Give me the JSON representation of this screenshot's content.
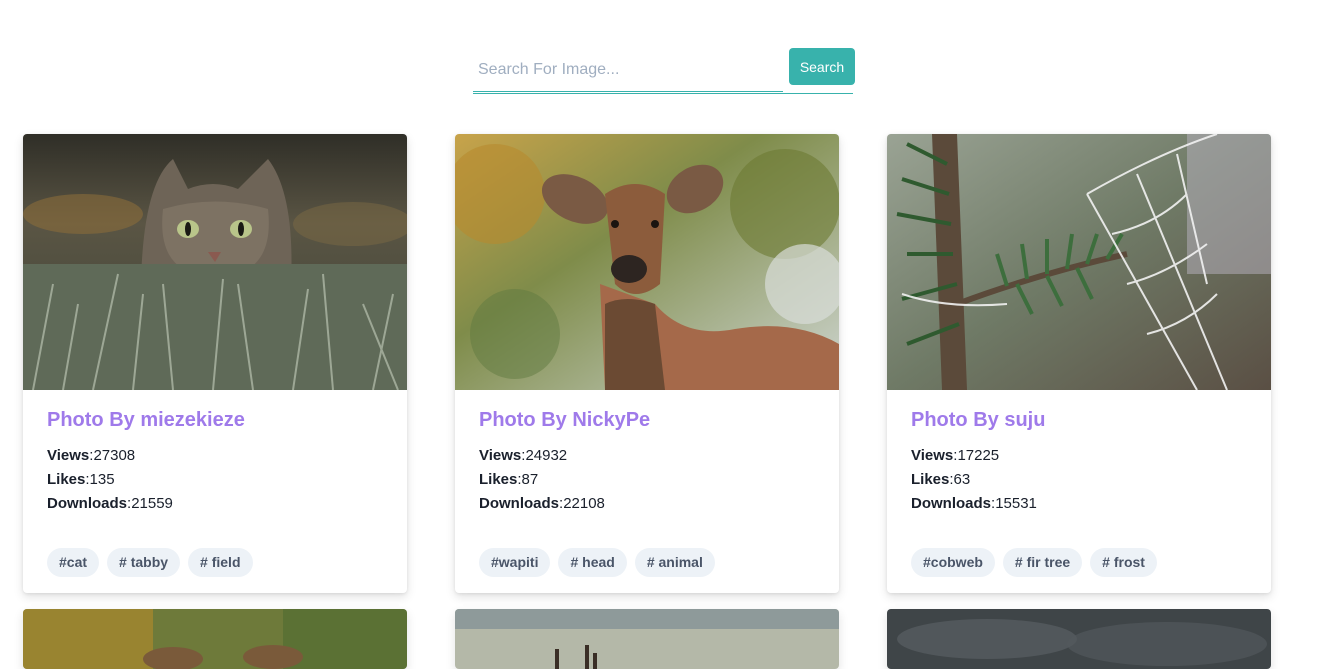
{
  "search": {
    "placeholder": "Search For Image...",
    "value": "",
    "button_label": "Search"
  },
  "cards": [
    {
      "title": "Photo By miezekieze",
      "views_label": "Views",
      "views": "27308",
      "likes_label": "Likes",
      "likes": "135",
      "downloads_label": "Downloads",
      "downloads": "21559",
      "tags": [
        "#cat",
        "# tabby",
        "# field"
      ]
    },
    {
      "title": "Photo By NickyPe",
      "views_label": "Views",
      "views": "24932",
      "likes_label": "Likes",
      "likes": "87",
      "downloads_label": "Downloads",
      "downloads": "22108",
      "tags": [
        "#wapiti",
        "# head",
        "# animal"
      ]
    },
    {
      "title": "Photo By suju",
      "views_label": "Views",
      "views": "17225",
      "likes_label": "Likes",
      "likes": "63",
      "downloads_label": "Downloads",
      "downloads": "15531",
      "tags": [
        "#cobweb",
        "# fir tree",
        "# frost"
      ]
    }
  ],
  "colors": {
    "accent": "#38b2ac",
    "title": "#9f7aea",
    "tag_bg": "#edf2f7",
    "tag_text": "#4a5568"
  }
}
